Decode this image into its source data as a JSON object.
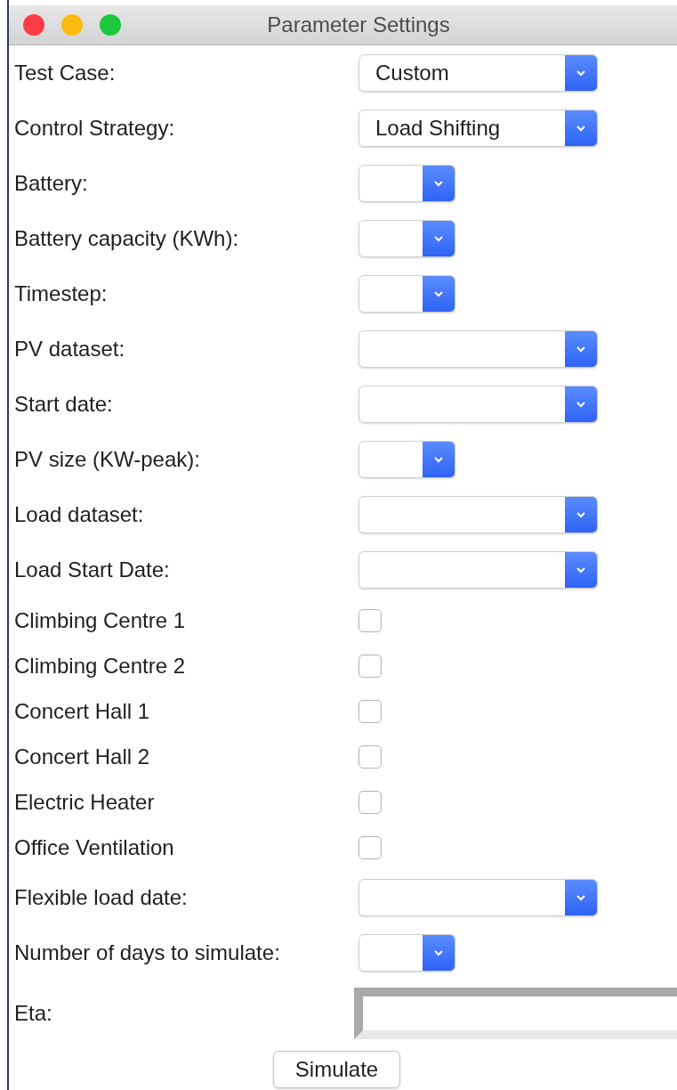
{
  "window": {
    "title": "Parameter Settings"
  },
  "rows": [
    {
      "label": "Test Case:",
      "kind": "select",
      "compact": false,
      "value": "Custom"
    },
    {
      "label": "Control Strategy:",
      "kind": "select",
      "compact": false,
      "value": "Load Shifting"
    },
    {
      "label": "Battery:",
      "kind": "select",
      "compact": true
    },
    {
      "label": "Battery capacity (KWh):",
      "kind": "select",
      "compact": true
    },
    {
      "label": "Timestep:",
      "kind": "select",
      "compact": true
    },
    {
      "label": "PV dataset:",
      "kind": "select",
      "compact": false
    },
    {
      "label": "Start date:",
      "kind": "select",
      "compact": false
    },
    {
      "label": "PV size (KW-peak):",
      "kind": "select",
      "compact": true
    },
    {
      "label": "Load dataset:",
      "kind": "select",
      "compact": false
    },
    {
      "label": "Load Start Date:",
      "kind": "select",
      "compact": false
    },
    {
      "label": "Climbing Centre 1",
      "kind": "checkbox",
      "checked": false
    },
    {
      "label": "Climbing Centre 2",
      "kind": "checkbox",
      "checked": false
    },
    {
      "label": "Concert Hall 1",
      "kind": "checkbox",
      "checked": false
    },
    {
      "label": "Concert Hall 2",
      "kind": "checkbox",
      "checked": false
    },
    {
      "label": "Electric Heater",
      "kind": "checkbox",
      "checked": false
    },
    {
      "label": "Office Ventilation",
      "kind": "checkbox",
      "checked": false
    },
    {
      "label": "Flexible load date:",
      "kind": "select",
      "compact": false
    },
    {
      "label": "Number of days to simulate:",
      "kind": "select",
      "compact": true
    },
    {
      "label": "Eta:",
      "kind": "field"
    }
  ],
  "buttons": [
    "Simulate"
  ]
}
